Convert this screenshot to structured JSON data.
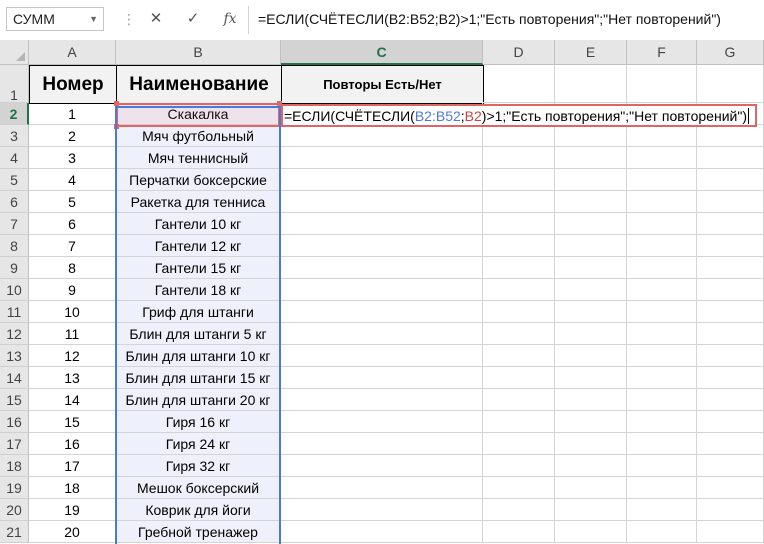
{
  "formula_bar": {
    "name_box": "СУММ",
    "formula": "=ЕСЛИ(СЧЁТЕСЛИ(B2:B52;B2)>1;\"Есть повторения\";\"Нет повторений\")"
  },
  "columns": [
    "A",
    "B",
    "C",
    "D",
    "E",
    "F",
    "G"
  ],
  "rows": [
    "1",
    "2",
    "3",
    "4",
    "5",
    "6",
    "7",
    "8",
    "9",
    "10",
    "11",
    "12",
    "13",
    "14",
    "15",
    "16",
    "17",
    "18",
    "19",
    "20",
    "21"
  ],
  "headers": {
    "a": "Номер",
    "b": "Наименование",
    "c": "Повторы Есть/Нет"
  },
  "data_rows": [
    {
      "num": "1",
      "name": "Скакалка"
    },
    {
      "num": "2",
      "name": "Мяч футбольный"
    },
    {
      "num": "3",
      "name": "Мяч теннисный"
    },
    {
      "num": "4",
      "name": "Перчатки боксерские"
    },
    {
      "num": "5",
      "name": "Ракетка для тенниса"
    },
    {
      "num": "6",
      "name": "Гантели 10 кг"
    },
    {
      "num": "7",
      "name": "Гантели 12 кг"
    },
    {
      "num": "8",
      "name": "Гантели 15 кг"
    },
    {
      "num": "9",
      "name": "Гантели 18 кг"
    },
    {
      "num": "10",
      "name": "Гриф для штанги"
    },
    {
      "num": "11",
      "name": "Блин для штанги 5 кг"
    },
    {
      "num": "12",
      "name": "Блин для штанги 10 кг"
    },
    {
      "num": "13",
      "name": "Блин для штанги 15 кг"
    },
    {
      "num": "14",
      "name": "Блин для штанги 20 кг"
    },
    {
      "num": "15",
      "name": "Гиря 16 кг"
    },
    {
      "num": "16",
      "name": "Гиря 24 кг"
    },
    {
      "num": "17",
      "name": "Гиря 32 кг"
    },
    {
      "num": "18",
      "name": "Мешок боксерский"
    },
    {
      "num": "19",
      "name": "Коврик для йоги"
    },
    {
      "num": "20",
      "name": "Гребной тренажер"
    }
  ],
  "edit_cell": {
    "p1": "=ЕСЛИ(СЧЁТЕСЛИ(",
    "ref_range": "B2:B52",
    "sep": ";",
    "ref_cell": "B2",
    "p2": ")>1;\"Есть повторения\";\"Нет повторений\")"
  },
  "colors": {
    "accent": "#217346",
    "range_blue": "#4a7ad8",
    "ref_red": "#e06666"
  },
  "icons": {
    "cancel": "✕",
    "enter": "✓",
    "function": "fx"
  }
}
